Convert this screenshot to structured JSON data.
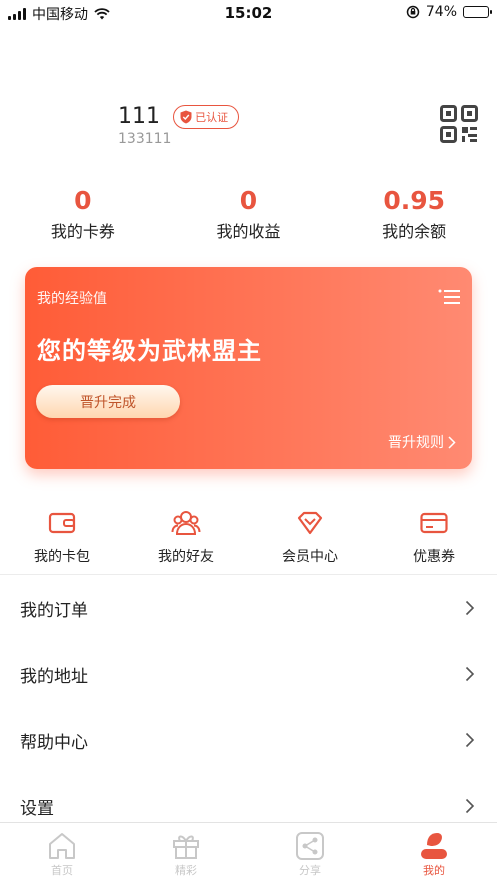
{
  "status_bar": {
    "carrier": "中国移动",
    "time": "15:02",
    "battery": "74%",
    "battery_level": 0.74
  },
  "profile": {
    "username": "111",
    "verified_badge": "已认证",
    "user_id": "133111"
  },
  "stats": [
    {
      "value": "0",
      "label": "我的卡券"
    },
    {
      "value": "0",
      "label": "我的收益"
    },
    {
      "value": "0.95",
      "label": "我的余额"
    }
  ],
  "level_card": {
    "subtitle": "我的经验值",
    "title": "您的等级为武林盟主",
    "button": "晋升完成",
    "rule_link": "晋升规则"
  },
  "actions": [
    {
      "label": "我的卡包",
      "icon": "wallet-icon"
    },
    {
      "label": "我的好友",
      "icon": "friends-icon"
    },
    {
      "label": "会员中心",
      "icon": "diamond-icon"
    },
    {
      "label": "优惠券",
      "icon": "card-icon"
    }
  ],
  "menu": [
    {
      "label": "我的订单"
    },
    {
      "label": "我的地址"
    },
    {
      "label": "帮助中心"
    },
    {
      "label": "设置"
    }
  ],
  "tabs": [
    {
      "label": "首页",
      "icon": "home-icon",
      "active": false
    },
    {
      "label": "精彩",
      "icon": "gift-icon",
      "active": false
    },
    {
      "label": "分享",
      "icon": "share-icon",
      "active": false
    },
    {
      "label": "我的",
      "icon": "profile-icon",
      "active": true
    }
  ],
  "colors": {
    "accent": "#e8553f",
    "card_gradient_start": "#ff5c37",
    "card_gradient_end": "#ff8a72",
    "tab_inactive": "#c8c8c8"
  }
}
